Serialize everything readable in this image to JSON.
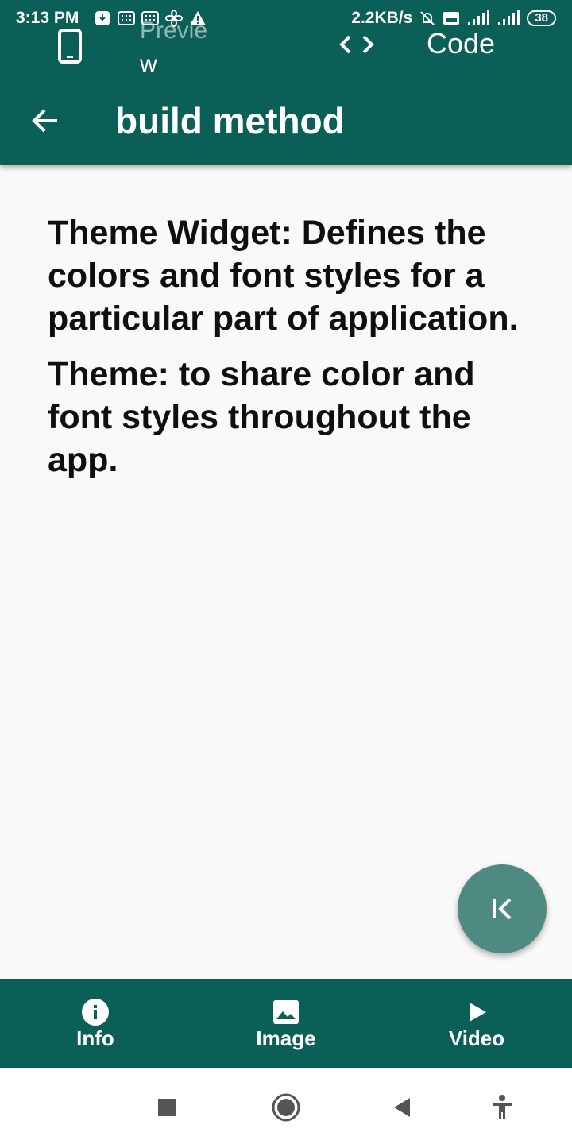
{
  "status_bar": {
    "time": "3:13 PM",
    "network_speed": "2.2KB/s",
    "battery": "38",
    "icons": [
      "download-icon",
      "keyboard-icon",
      "keyboard-icon",
      "fan-icon",
      "warning-icon",
      "bell-off-icon",
      "volte-icon",
      "signal-4g-icon",
      "signal-icon"
    ]
  },
  "top_tabs": {
    "preview_label": "Previe",
    "preview_label_wrap": "w",
    "code_label": "Code",
    "preview_icon": "phone-icon",
    "code_icon": "code-icon"
  },
  "app_bar": {
    "title": "build method",
    "back_icon": "arrow-back-icon"
  },
  "content": {
    "paragraphs": [
      "Theme Widget: Defines the colors and font styles for a particular part of application.",
      "Theme: to share color and font styles throughout the app."
    ]
  },
  "fab": {
    "icon": "first-page-icon"
  },
  "bottom_nav": {
    "items": [
      {
        "label": "Info",
        "icon": "info-icon"
      },
      {
        "label": "Image",
        "icon": "image-icon"
      },
      {
        "label": "Video",
        "icon": "play-icon"
      }
    ]
  },
  "system_nav": {
    "icons": [
      "recents-square-icon",
      "home-circle-icon",
      "back-triangle-icon",
      "accessibility-icon"
    ]
  },
  "colors": {
    "primary": "#0a5f56",
    "fab": "#4f8a82",
    "background": "#f9f9f9",
    "text": "#0f0f0f"
  }
}
